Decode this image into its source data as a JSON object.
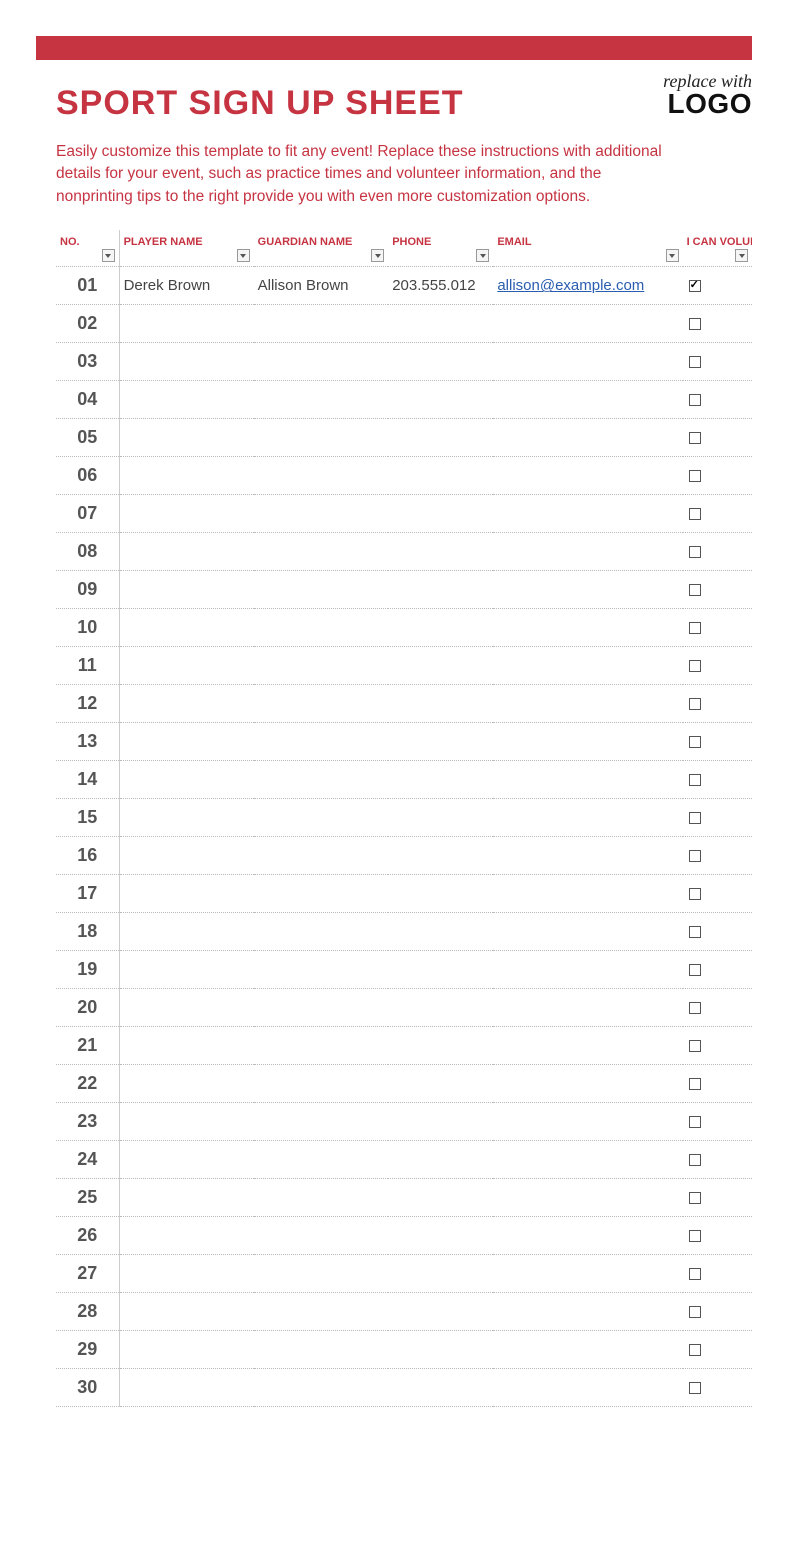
{
  "header": {
    "title": "SPORT SIGN UP SHEET",
    "logo_line1": "replace with",
    "logo_line2": "LOGO"
  },
  "intro": "Easily customize this template to fit any event! Replace these instructions with additional details for your event, such as practice times and volunteer information, and the nonprinting tips to the right provide you with even more customization options.",
  "table": {
    "headers": {
      "no": "NO.",
      "player": "PLAYER NAME",
      "guardian": "GUARDIAN NAME",
      "phone": "PHONE",
      "email": "EMAIL",
      "volunteer": "I CAN VOLUNTEER"
    },
    "rows": [
      {
        "no": "01",
        "player": "Derek Brown",
        "guardian": "Allison Brown",
        "phone": "203.555.012",
        "email": "allison@example.com",
        "volunteer": true
      },
      {
        "no": "02",
        "player": "",
        "guardian": "",
        "phone": "",
        "email": "",
        "volunteer": false
      },
      {
        "no": "03",
        "player": "",
        "guardian": "",
        "phone": "",
        "email": "",
        "volunteer": false
      },
      {
        "no": "04",
        "player": "",
        "guardian": "",
        "phone": "",
        "email": "",
        "volunteer": false
      },
      {
        "no": "05",
        "player": "",
        "guardian": "",
        "phone": "",
        "email": "",
        "volunteer": false
      },
      {
        "no": "06",
        "player": "",
        "guardian": "",
        "phone": "",
        "email": "",
        "volunteer": false
      },
      {
        "no": "07",
        "player": "",
        "guardian": "",
        "phone": "",
        "email": "",
        "volunteer": false
      },
      {
        "no": "08",
        "player": "",
        "guardian": "",
        "phone": "",
        "email": "",
        "volunteer": false
      },
      {
        "no": "09",
        "player": "",
        "guardian": "",
        "phone": "",
        "email": "",
        "volunteer": false
      },
      {
        "no": "10",
        "player": "",
        "guardian": "",
        "phone": "",
        "email": "",
        "volunteer": false
      },
      {
        "no": "11",
        "player": "",
        "guardian": "",
        "phone": "",
        "email": "",
        "volunteer": false
      },
      {
        "no": "12",
        "player": "",
        "guardian": "",
        "phone": "",
        "email": "",
        "volunteer": false
      },
      {
        "no": "13",
        "player": "",
        "guardian": "",
        "phone": "",
        "email": "",
        "volunteer": false
      },
      {
        "no": "14",
        "player": "",
        "guardian": "",
        "phone": "",
        "email": "",
        "volunteer": false
      },
      {
        "no": "15",
        "player": "",
        "guardian": "",
        "phone": "",
        "email": "",
        "volunteer": false
      },
      {
        "no": "16",
        "player": "",
        "guardian": "",
        "phone": "",
        "email": "",
        "volunteer": false
      },
      {
        "no": "17",
        "player": "",
        "guardian": "",
        "phone": "",
        "email": "",
        "volunteer": false
      },
      {
        "no": "18",
        "player": "",
        "guardian": "",
        "phone": "",
        "email": "",
        "volunteer": false
      },
      {
        "no": "19",
        "player": "",
        "guardian": "",
        "phone": "",
        "email": "",
        "volunteer": false
      },
      {
        "no": "20",
        "player": "",
        "guardian": "",
        "phone": "",
        "email": "",
        "volunteer": false
      },
      {
        "no": "21",
        "player": "",
        "guardian": "",
        "phone": "",
        "email": "",
        "volunteer": false
      },
      {
        "no": "22",
        "player": "",
        "guardian": "",
        "phone": "",
        "email": "",
        "volunteer": false
      },
      {
        "no": "23",
        "player": "",
        "guardian": "",
        "phone": "",
        "email": "",
        "volunteer": false
      },
      {
        "no": "24",
        "player": "",
        "guardian": "",
        "phone": "",
        "email": "",
        "volunteer": false
      },
      {
        "no": "25",
        "player": "",
        "guardian": "",
        "phone": "",
        "email": "",
        "volunteer": false
      },
      {
        "no": "26",
        "player": "",
        "guardian": "",
        "phone": "",
        "email": "",
        "volunteer": false
      },
      {
        "no": "27",
        "player": "",
        "guardian": "",
        "phone": "",
        "email": "",
        "volunteer": false
      },
      {
        "no": "28",
        "player": "",
        "guardian": "",
        "phone": "",
        "email": "",
        "volunteer": false
      },
      {
        "no": "29",
        "player": "",
        "guardian": "",
        "phone": "",
        "email": "",
        "volunteer": false
      },
      {
        "no": "30",
        "player": "",
        "guardian": "",
        "phone": "",
        "email": "",
        "volunteer": false
      }
    ]
  }
}
